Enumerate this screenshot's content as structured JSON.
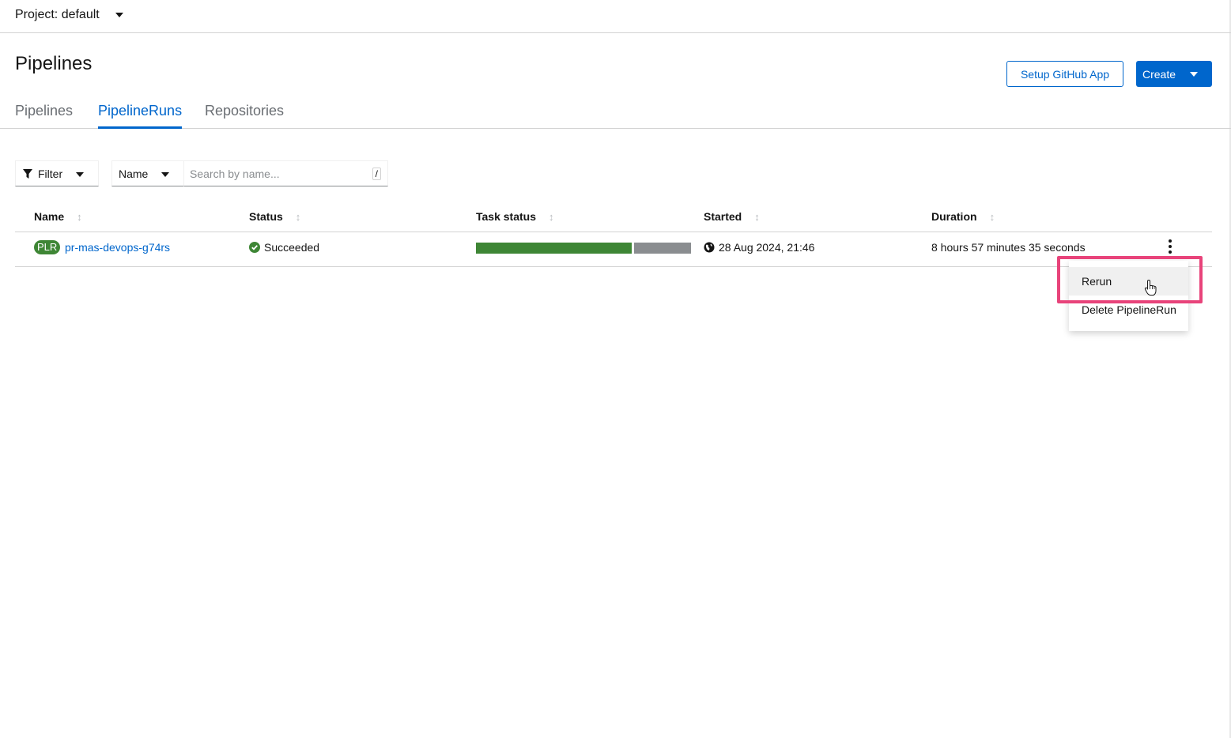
{
  "project": {
    "label": "Project: default"
  },
  "page": {
    "title": "Pipelines"
  },
  "actions": {
    "setup_github": "Setup GitHub App",
    "create": "Create"
  },
  "tabs": [
    {
      "label": "Pipelines",
      "active": false
    },
    {
      "label": "PipelineRuns",
      "active": true
    },
    {
      "label": "Repositories",
      "active": false
    }
  ],
  "toolbar": {
    "filter_label": "Filter",
    "name_select": "Name",
    "search_placeholder": "Search by name...",
    "search_shortcut": "/"
  },
  "table": {
    "columns": [
      "Name",
      "Status",
      "Task status",
      "Started",
      "Duration"
    ],
    "rows": [
      {
        "badge": "PLR",
        "name": "pr-mas-devops-g74rs",
        "status": "Succeeded",
        "task_status": {
          "succeeded_fraction": 0.73,
          "other_fraction": 0.27
        },
        "started": "28 Aug 2024, 21:46",
        "duration": "8 hours 57 minutes 35 seconds"
      }
    ]
  },
  "row_menu": {
    "items": [
      "Rerun",
      "Delete PipelineRun"
    ]
  },
  "colors": {
    "primary": "#0066cc",
    "success": "#3e8635",
    "neutral": "#8a8d90",
    "highlight": "#e8437a"
  }
}
